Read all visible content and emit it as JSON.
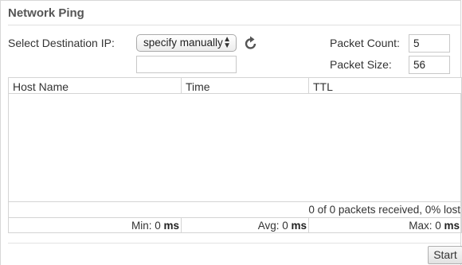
{
  "panel": {
    "title": "Network Ping"
  },
  "form": {
    "dest_label": "Select Destination IP:",
    "dest_select_value": "specify manually",
    "manual_ip_value": "",
    "count_label": "Packet Count:",
    "count_value": "5",
    "size_label": "Packet Size:",
    "size_value": "56"
  },
  "table": {
    "headers": [
      "Host Name",
      "Time",
      "TTL"
    ],
    "summary": "0 of 0 packets received, 0% lost",
    "stats": {
      "min_label": "Min: 0",
      "avg_label": "Avg: 0",
      "max_label": "Max: 0",
      "unit": "ms"
    }
  },
  "actions": {
    "start_label": "Start"
  },
  "icons": {
    "refresh": "refresh-icon",
    "select_arrows": "up-down-arrows-icon"
  }
}
